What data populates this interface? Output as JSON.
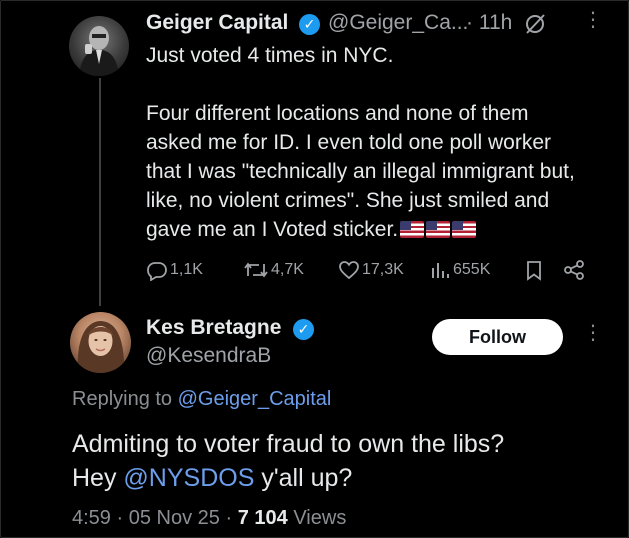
{
  "tweet": {
    "author_name": "Geiger Capital",
    "author_handle": "@Geiger_Ca...",
    "time": "· 11h",
    "text_line1": "Just voted 4 times in NYC.",
    "text_para2": "Four different locations and none of them asked me for ID. I even told one poll worker that I was \"technically an illegal immigrant but, like, no violent crimes\". She just smiled and gave me an I Voted sticker.",
    "flag_count": 3,
    "actions": {
      "replies": "1,1K",
      "reposts": "4,7K",
      "likes": "17,3K",
      "views": "655K"
    }
  },
  "reply": {
    "author_name": "Kes Bretagne",
    "author_handle": "@KesendraB",
    "follow_label": "Follow",
    "replying_prefix": "Replying to",
    "replying_handle": "@Geiger_Capital",
    "text_line1": "Admiting to voter fraud to own the libs?",
    "text_hey": "Hey",
    "text_mention": "@NYSDOS",
    "text_end": "y'all up?",
    "time": "4:59",
    "date": "05 Nov 25",
    "views_count": "7 104",
    "views_label": "Views",
    "separator": "·"
  },
  "colors": {
    "background": "#000000",
    "text": "#e7e9ea",
    "muted": "#8b8f93",
    "link": "#6d9eeb",
    "verified": "#1d9bf0"
  },
  "icons": [
    "reply-icon",
    "repost-icon",
    "like-icon",
    "views-icon",
    "bookmark-icon",
    "share-icon",
    "verified-badge-icon",
    "grok-icon",
    "more-icon"
  ]
}
